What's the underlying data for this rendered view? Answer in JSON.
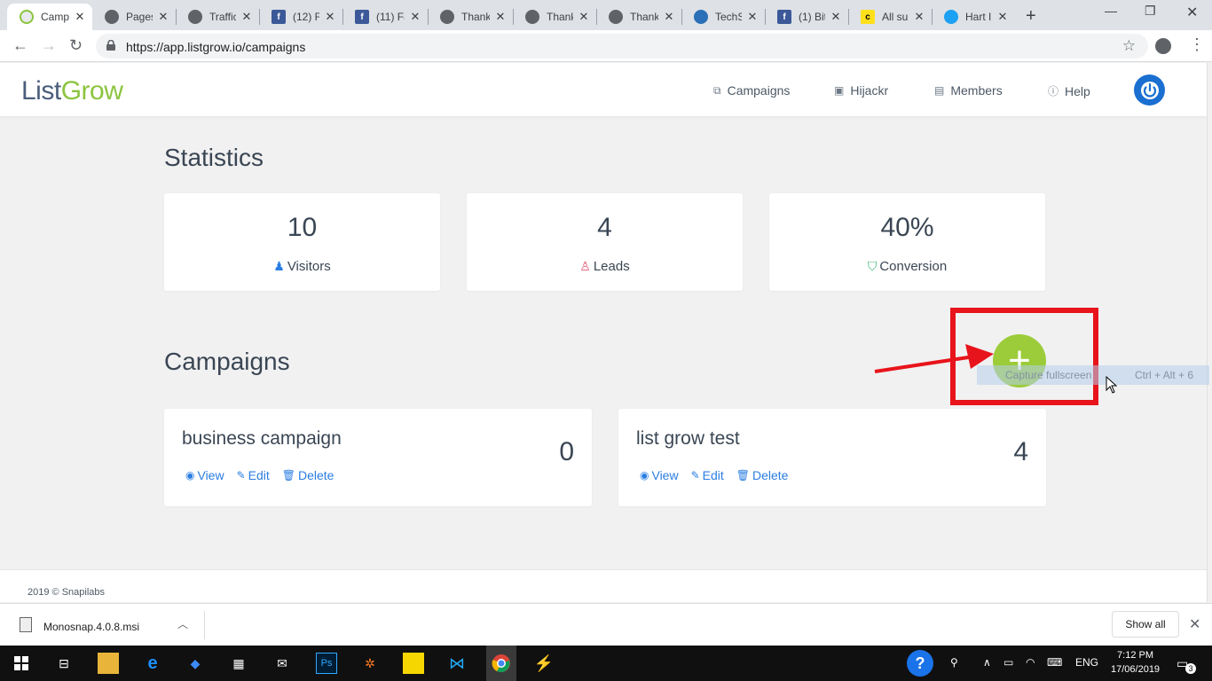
{
  "browser": {
    "tabs": [
      {
        "title": "Camp",
        "favicon": "listgrow-icon",
        "active": true
      },
      {
        "title": "Pages",
        "favicon": "globe-icon"
      },
      {
        "title": "Traffic",
        "favicon": "globe-icon"
      },
      {
        "title": "(12) Fa",
        "favicon": "facebook-icon"
      },
      {
        "title": "(11) Fa",
        "favicon": "facebook-icon"
      },
      {
        "title": "Thank",
        "favicon": "globe-icon"
      },
      {
        "title": "Thank",
        "favicon": "globe-icon"
      },
      {
        "title": "Thank",
        "favicon": "globe-icon"
      },
      {
        "title": "TechS",
        "favicon": "techsmith-icon"
      },
      {
        "title": "(1) Bit",
        "favicon": "facebook-icon"
      },
      {
        "title": "All su",
        "favicon": "mailchimp-icon"
      },
      {
        "title": "Hart I",
        "favicon": "twitter-icon"
      }
    ],
    "url": "https://app.listgrow.io/campaigns"
  },
  "app": {
    "logo_part1": "List",
    "logo_part2": "Grow",
    "nav": [
      {
        "label": "Campaigns",
        "icon": "campaigns-icon"
      },
      {
        "label": "Hijackr",
        "icon": "image-icon"
      },
      {
        "label": "Members",
        "icon": "members-icon"
      },
      {
        "label": "Help",
        "icon": "help-icon"
      }
    ],
    "colors": {
      "brand_blue": "#4a5e7a",
      "brand_green": "#8cc43f",
      "link": "#2a7de1",
      "add_button": "#9ccc3a",
      "power": "#1a6fd1"
    }
  },
  "statistics": {
    "title": "Statistics",
    "cards": [
      {
        "value": "10",
        "label": "Visitors",
        "icon": "visitors-icon",
        "icon_color": "#2a7de1"
      },
      {
        "value": "4",
        "label": "Leads",
        "icon": "leads-icon",
        "icon_color": "#e2526b"
      },
      {
        "value": "40%",
        "label": "Conversion",
        "icon": "bag-icon",
        "icon_color": "#3cb878"
      }
    ]
  },
  "campaigns": {
    "title": "Campaigns",
    "items": [
      {
        "name": "business campaign",
        "count": "0"
      },
      {
        "name": "list grow test",
        "count": "4"
      }
    ],
    "actions": {
      "view": "View",
      "edit": "Edit",
      "delete": "Delete"
    },
    "add_symbol": "+"
  },
  "overlay": {
    "tooltip_left": "Capture fullscreen",
    "tooltip_right": "Ctrl + Alt + 6"
  },
  "footer": {
    "text": "2019 © Snapilabs"
  },
  "download_shelf": {
    "file": "Monosnap.4.0.8.msi",
    "show_all": "Show all"
  },
  "taskbar": {
    "lang": "ENG",
    "time": "7:12 PM",
    "date": "17/06/2019",
    "notifications": "3"
  }
}
